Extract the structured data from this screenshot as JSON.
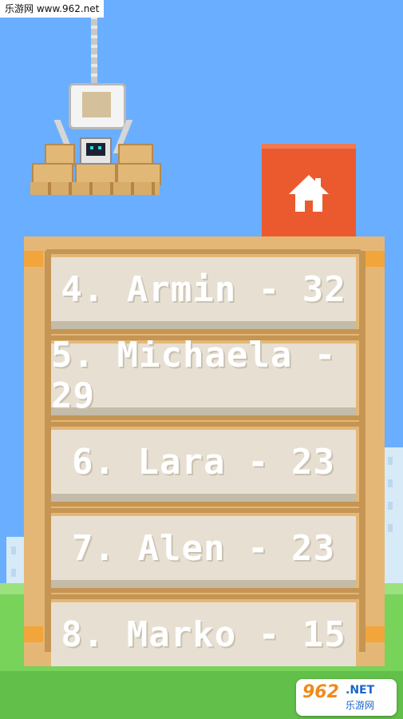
{
  "watermark": {
    "top_text": "乐游网 www.962.net",
    "bottom_brand": "962",
    "bottom_domain": ".NET",
    "bottom_cn": "乐游网"
  },
  "home_button": {
    "icon": "house-icon",
    "color": "#ea5a2e"
  },
  "leaderboard": {
    "entries": [
      {
        "label": "4. Armin - 32"
      },
      {
        "label": "5. Michaela - 29"
      },
      {
        "label": "6. Lara - 23"
      },
      {
        "label": "7. Alen - 23"
      },
      {
        "label": "8. Marko - 15"
      }
    ]
  },
  "colors": {
    "sky": "#6aaeff",
    "grass": "#78d35a",
    "crate": "#e5b777",
    "row": "#e7e0d2",
    "accent": "#ea5a2e"
  }
}
